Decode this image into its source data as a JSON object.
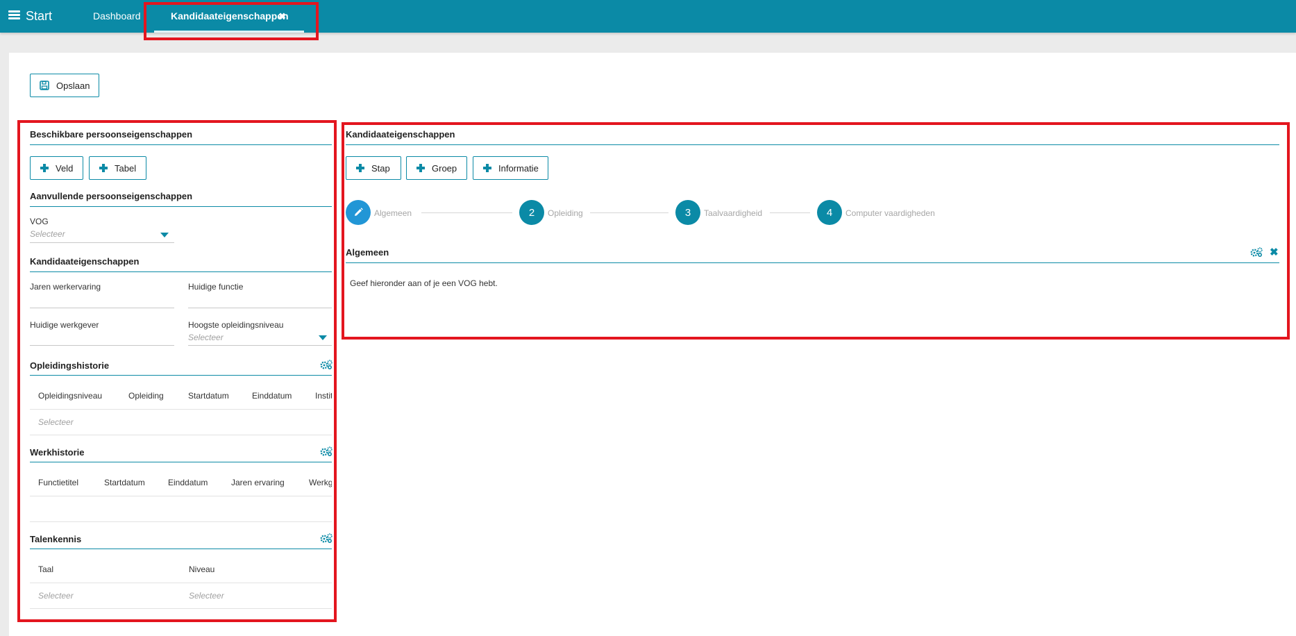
{
  "topbar": {
    "start_label": "Start",
    "tabs": [
      {
        "label": "Dashboard"
      },
      {
        "label": "Kandidaateigenschappen"
      }
    ]
  },
  "toolbar": {
    "save_label": "Opslaan"
  },
  "left_panel": {
    "title": "Beschikbare persoonseigenschappen",
    "buttons": {
      "veld": "Veld",
      "tabel": "Tabel"
    },
    "aanvullende": {
      "title": "Aanvullende persoonseigenschappen",
      "vog_label": "VOG",
      "vog_placeholder": "Selecteer"
    },
    "kandidaat": {
      "title": "Kandidaateigenschappen",
      "fields": {
        "jaren": "Jaren werkervaring",
        "functie": "Huidige functie",
        "werkgever": "Huidige werkgever",
        "opleidingsniveau": "Hoogste opleidingsniveau",
        "opleidingsniveau_placeholder": "Selecteer"
      }
    },
    "opleidingshistorie": {
      "title": "Opleidingshistorie",
      "columns": [
        "Opleidingsniveau",
        "Opleiding",
        "Startdatum",
        "Einddatum",
        "Instituut"
      ],
      "row_placeholder": "Selecteer"
    },
    "werkhistorie": {
      "title": "Werkhistorie",
      "columns": [
        "Functietitel",
        "Startdatum",
        "Einddatum",
        "Jaren ervaring",
        "Werkgever"
      ]
    },
    "talenkennis": {
      "title": "Talenkennis",
      "columns": [
        "Taal",
        "Niveau"
      ],
      "placeholders": [
        "Selecteer",
        "Selecteer"
      ]
    }
  },
  "right_panel": {
    "title": "Kandidaateigenschappen",
    "buttons": {
      "stap": "Stap",
      "groep": "Groep",
      "informatie": "Informatie"
    },
    "steps": [
      {
        "number": "",
        "label": "Algemeen"
      },
      {
        "number": "2",
        "label": "Opleiding"
      },
      {
        "number": "3",
        "label": "Taalvaardigheid"
      },
      {
        "number": "4",
        "label": "Computer vaardigheden"
      }
    ],
    "section": {
      "title": "Algemeen",
      "description": "Geef hieronder aan of je een VOG hebt."
    }
  },
  "colors": {
    "accent": "#0b8aa6",
    "highlight": "#e3161f",
    "edit_step": "#2196d6"
  }
}
